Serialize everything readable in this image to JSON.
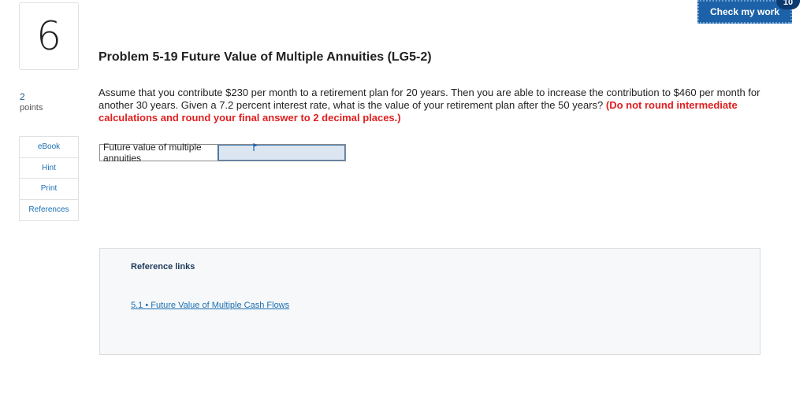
{
  "question": {
    "number": "6",
    "points_value": "2",
    "points_label": "points"
  },
  "tools": [
    {
      "label": "eBook"
    },
    {
      "label": "Hint"
    },
    {
      "label": "Print"
    },
    {
      "label": "References"
    }
  ],
  "check_button": {
    "label": "Check my work",
    "badge": "10"
  },
  "problem": {
    "title": "Problem 5-19 Future Value of Multiple Annuities (LG5-2)",
    "text": "Assume that you contribute $230 per month to a retirement plan for 20 years. Then you are able to increase the contribution to $460 per month for another 30 years. Given a 7.2 percent interest rate, what is the value of your retirement plan after the 50 years?",
    "instruction": "(Do not round intermediate calculations and round your final answer to 2 decimal places.)"
  },
  "answer": {
    "label": "Future value of multiple annuities",
    "value": ""
  },
  "references": {
    "title": "Reference links",
    "link": "5.1 • Future Value of Multiple Cash Flows"
  },
  "colors": {
    "accent": "#1d62a8",
    "badge": "#0d3a70",
    "instruction_red": "#e02020",
    "link": "#1a6fb3"
  }
}
